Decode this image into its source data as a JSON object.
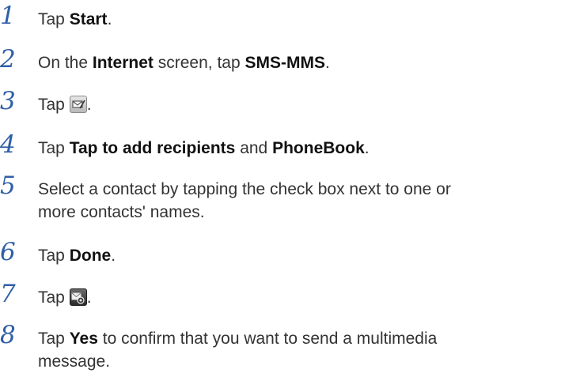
{
  "steps": [
    {
      "number": "1",
      "parts": [
        "Tap ",
        "Start",
        "."
      ]
    },
    {
      "number": "2",
      "parts": [
        "On the ",
        "Internet",
        " screen, tap ",
        "SMS-MMS",
        "."
      ]
    },
    {
      "number": "3",
      "parts": [
        "Tap ",
        "."
      ],
      "icon": "compose-message-icon"
    },
    {
      "number": "4",
      "parts": [
        "Tap ",
        "Tap to add recipients",
        " and ",
        "PhoneBook",
        "."
      ]
    },
    {
      "number": "5",
      "line1": "Select a contact by tapping the check box next to one or",
      "line2": "more contacts' names."
    },
    {
      "number": "6",
      "parts": [
        "Tap ",
        "Done",
        "."
      ]
    },
    {
      "number": "7",
      "parts": [
        "Tap ",
        "."
      ],
      "icon": "multimedia-message-icon"
    },
    {
      "number": "8",
      "parts": [
        "Tap ",
        "Yes",
        " to confirm that you want to send a multimedia"
      ],
      "line2": "message."
    }
  ]
}
